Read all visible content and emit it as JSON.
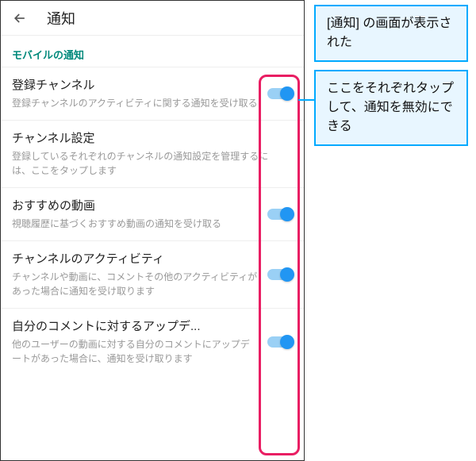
{
  "appbar": {
    "title": "通知"
  },
  "section": {
    "header": "モバイルの通知"
  },
  "items": [
    {
      "title": "登録チャンネル",
      "desc": "登録チャンネルのアクティビティに関する通知を受け取る",
      "toggle": true
    },
    {
      "title": "チャンネル設定",
      "desc": "登録しているそれぞれのチャンネルの通知設定を管理するには、ここをタップします",
      "toggle": false
    },
    {
      "title": "おすすめの動画",
      "desc": "視聴履歴に基づくおすすめ動画の通知を受け取る",
      "toggle": true
    },
    {
      "title": "チャンネルのアクティビティ",
      "desc": "チャンネルや動画に、コメントその他のアクティビティがあった場合に通知を受け取ります",
      "toggle": true
    },
    {
      "title": "自分のコメントに対するアップデ...",
      "desc": "他のユーザーの動画に対する自分のコメントにアップデートがあった場合に、通知を受け取ります",
      "toggle": true
    }
  ],
  "callouts": {
    "c1": "[通知] の画面が表示された",
    "c2": "ここをそれぞれタップして、通知を無効にできる"
  }
}
